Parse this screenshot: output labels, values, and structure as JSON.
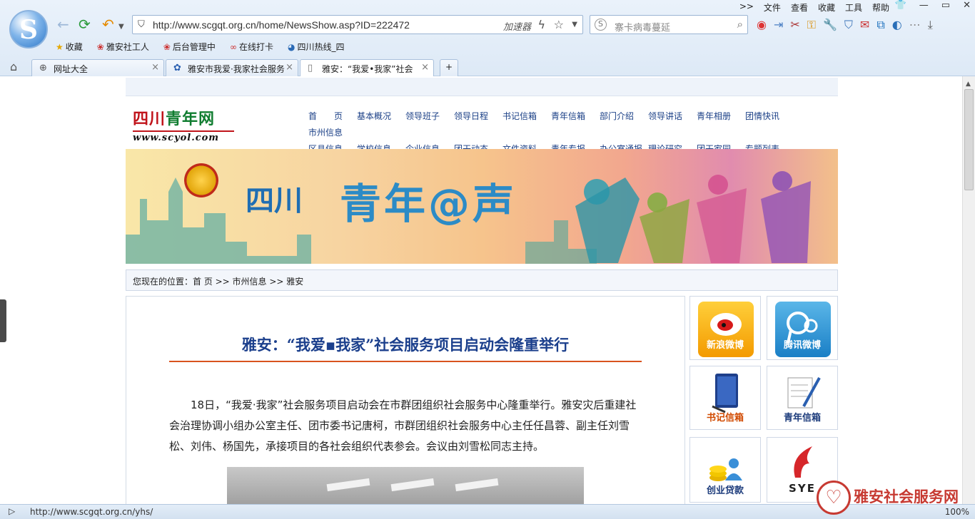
{
  "browser": {
    "menu": [
      ">>",
      "文件",
      "查看",
      "收藏",
      "工具",
      "帮助"
    ],
    "address_url": "http://www.scgqt.org.cn/home/NewsShow.asp?ID=222472",
    "accelerator_label": "加速器",
    "search_placeholder": "寨卡病毒蔓延",
    "bookmarks": [
      "收藏",
      "雅安社工人",
      "后台管理中",
      "在线打卡",
      "四川热线_四"
    ],
    "tabs": [
      {
        "label": "网址大全"
      },
      {
        "label": "雅安市我爱·我家社会服务"
      },
      {
        "label": "雅安：“我爱•我家”社会"
      }
    ],
    "status_url": "http://www.scgqt.org.cn/yhs/",
    "zoom": "100%"
  },
  "site": {
    "logo_cn_a": "四川",
    "logo_cn_b": "青年网",
    "logo_en": "www.scyol.com",
    "nav_row1": [
      "首　　页",
      "基本概况",
      "领导班子",
      "领导日程",
      "书记信箱",
      "青年信箱",
      "部门介绍",
      "领导讲话",
      "青年相册",
      "团情快讯",
      "市州信息"
    ],
    "nav_row2": [
      "区县信息",
      "学校信息",
      "企业信息",
      "团干动态",
      "文件资料",
      "青年专报",
      "办公室通报",
      "理论研究",
      "团干家园",
      "专题列表"
    ],
    "banner_sc": "四川",
    "banner_title": "青年@声",
    "breadcrumb": "您现在的位置：首 页 >> 市州信息 >> 雅安"
  },
  "article": {
    "title": "雅安：“我爱▪我家”社会服务项目启动会隆重举行",
    "body": "18日，“我爱·我家”社会服务项目启动会在市群团组织社会服务中心隆重举行。雅安灾后重建社会治理协调小组办公室主任、团市委书记唐柯，市群团组织社会服务中心主任任昌蓉、副主任刘雪松、刘伟、杨国先，承接项目的各社会组织代表参会。会议由刘雪松同志主持。"
  },
  "sidebar": {
    "weibo_sina": "新浪微博",
    "weibo_tencent": "腾讯微博",
    "secretary_mail": "书记信箱",
    "youth_mail": "青年信箱",
    "loan": "创业贷款",
    "sye": "SYE"
  },
  "watermark": "雅安社会服务网"
}
